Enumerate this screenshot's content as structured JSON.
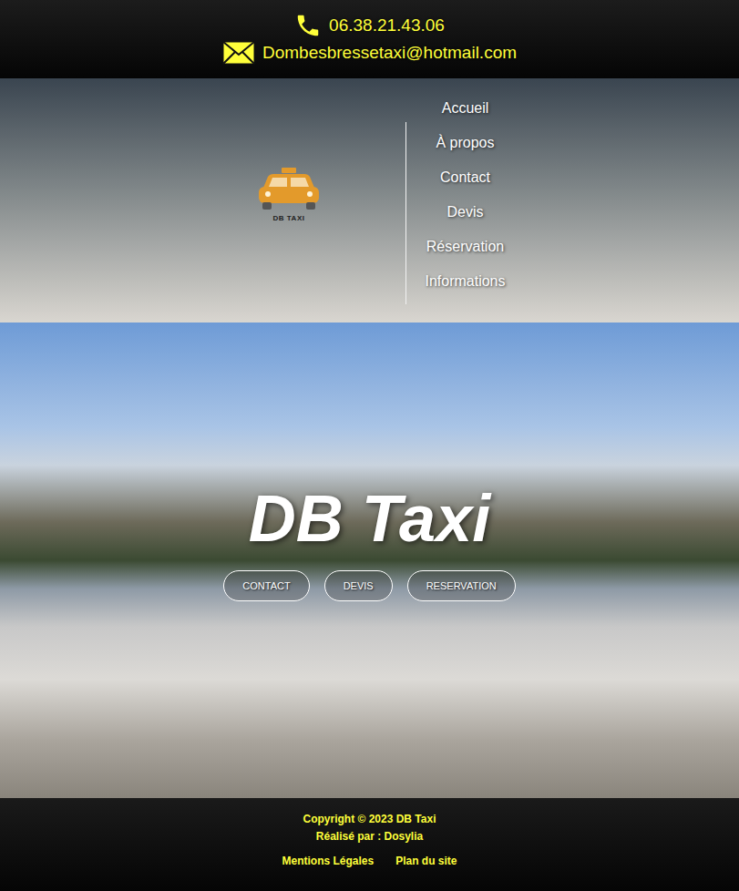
{
  "contact": {
    "phone": "06.38.21.43.06",
    "email": "Dombesbressetaxi@hotmail.com"
  },
  "logo": {
    "text": "DB TAXI"
  },
  "nav": {
    "items": [
      {
        "label": "Accueil"
      },
      {
        "label": "À propos"
      },
      {
        "label": "Contact"
      },
      {
        "label": "Devis"
      },
      {
        "label": "Réservation"
      },
      {
        "label": "Informations"
      }
    ]
  },
  "hero": {
    "title": "DB Taxi",
    "buttons": [
      "CONTACT",
      "DEVIS",
      "RESERVATION"
    ]
  },
  "footer": {
    "copyright": "Copyright © 2023 DB Taxi",
    "credit": "Réalisé par : Dosylia",
    "links": [
      "Mentions Légales",
      "Plan du site"
    ]
  }
}
